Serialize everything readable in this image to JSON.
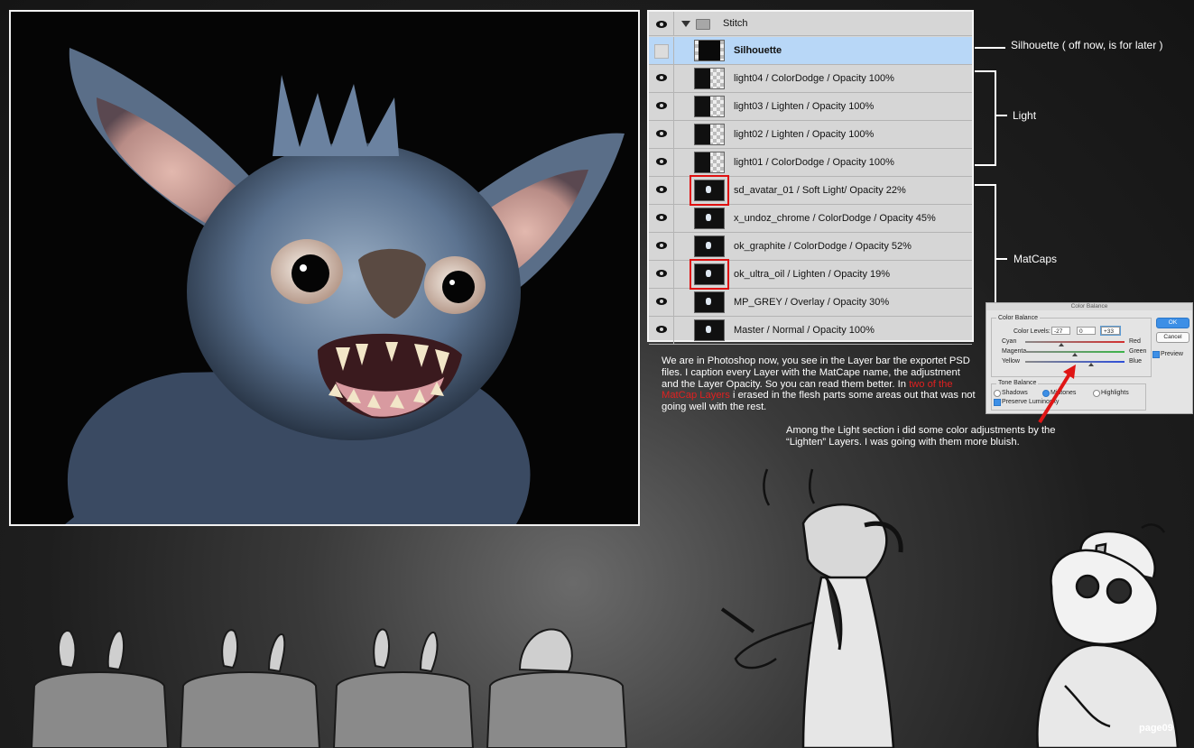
{
  "layers_panel": {
    "group": {
      "name": "Stitch"
    },
    "layers": [
      {
        "name": "Silhouette",
        "visible": false,
        "selected": true,
        "bold": true,
        "highlight": false,
        "thumb": "silhouette"
      },
      {
        "name": "light04 / ColorDodge / Opacity 100%",
        "visible": true,
        "selected": false,
        "highlight": false,
        "thumb": "dark"
      },
      {
        "name": "light03 / Lighten / Opacity 100%",
        "visible": true,
        "selected": false,
        "highlight": false,
        "thumb": "dark"
      },
      {
        "name": "light02 / Lighten / Opacity 100%",
        "visible": true,
        "selected": false,
        "highlight": false,
        "thumb": "dark"
      },
      {
        "name": "light01 / ColorDodge / Opacity 100%",
        "visible": true,
        "selected": false,
        "highlight": false,
        "thumb": "dark"
      },
      {
        "name": "sd_avatar_01 / Soft Light/ Opacity 22%",
        "visible": true,
        "selected": false,
        "highlight": true,
        "thumb": "matcap"
      },
      {
        "name": "x_undoz_chrome / ColorDodge / Opacity 45%",
        "visible": true,
        "selected": false,
        "highlight": false,
        "thumb": "matcap"
      },
      {
        "name": "ok_graphite / ColorDodge / Opacity 52%",
        "visible": true,
        "selected": false,
        "highlight": false,
        "thumb": "matcap"
      },
      {
        "name": "ok_ultra_oil / Lighten / Opacity 19%",
        "visible": true,
        "selected": false,
        "highlight": true,
        "thumb": "matcap"
      },
      {
        "name": "MP_GREY / Overlay / Opacity 30%",
        "visible": true,
        "selected": false,
        "highlight": false,
        "thumb": "matcap"
      },
      {
        "name": "Master / Normal / Opacity 100%",
        "visible": true,
        "selected": false,
        "highlight": false,
        "thumb": "matcap"
      }
    ]
  },
  "annotations": {
    "silhouette": "Silhouette  ( off now, is for later )",
    "light": "Light",
    "matcaps": "MatCaps"
  },
  "caption": {
    "part1": "We are in Photoshop now, you see in the Layer bar the exportet PSD files. I caption every Layer with the MatCape name, the adjustment and the Layer Opacity. So you can read them better. In ",
    "highlight": "two of the MatCap Layers",
    "part2": " i erased in the flesh parts some areas out that was not going well with the rest."
  },
  "caption2": "Among the Light section i did some color adjustments by the “Lighten” Layers. I was going with them more bluish.",
  "color_balance": {
    "title": "Color Balance",
    "section": "Color Balance",
    "levels_label": "Color Levels:",
    "levels": [
      "-27",
      "0",
      "+33"
    ],
    "sliders": [
      {
        "left": "Cyan",
        "right": "Red",
        "value": -27,
        "color": "#d23030"
      },
      {
        "left": "Magenta",
        "right": "Green",
        "value": 0,
        "color": "#3db34a"
      },
      {
        "left": "Yellow",
        "right": "Blue",
        "value": 33,
        "color": "#2f4fd8"
      }
    ],
    "tone_section": "Tone Balance",
    "tones": [
      "Shadows",
      "Midtones",
      "Highlights"
    ],
    "selected_tone": "Midtones",
    "preserve": "Preserve Luminosity",
    "ok": "OK",
    "cancel": "Cancel",
    "preview": "Preview"
  },
  "page_number": "page09"
}
